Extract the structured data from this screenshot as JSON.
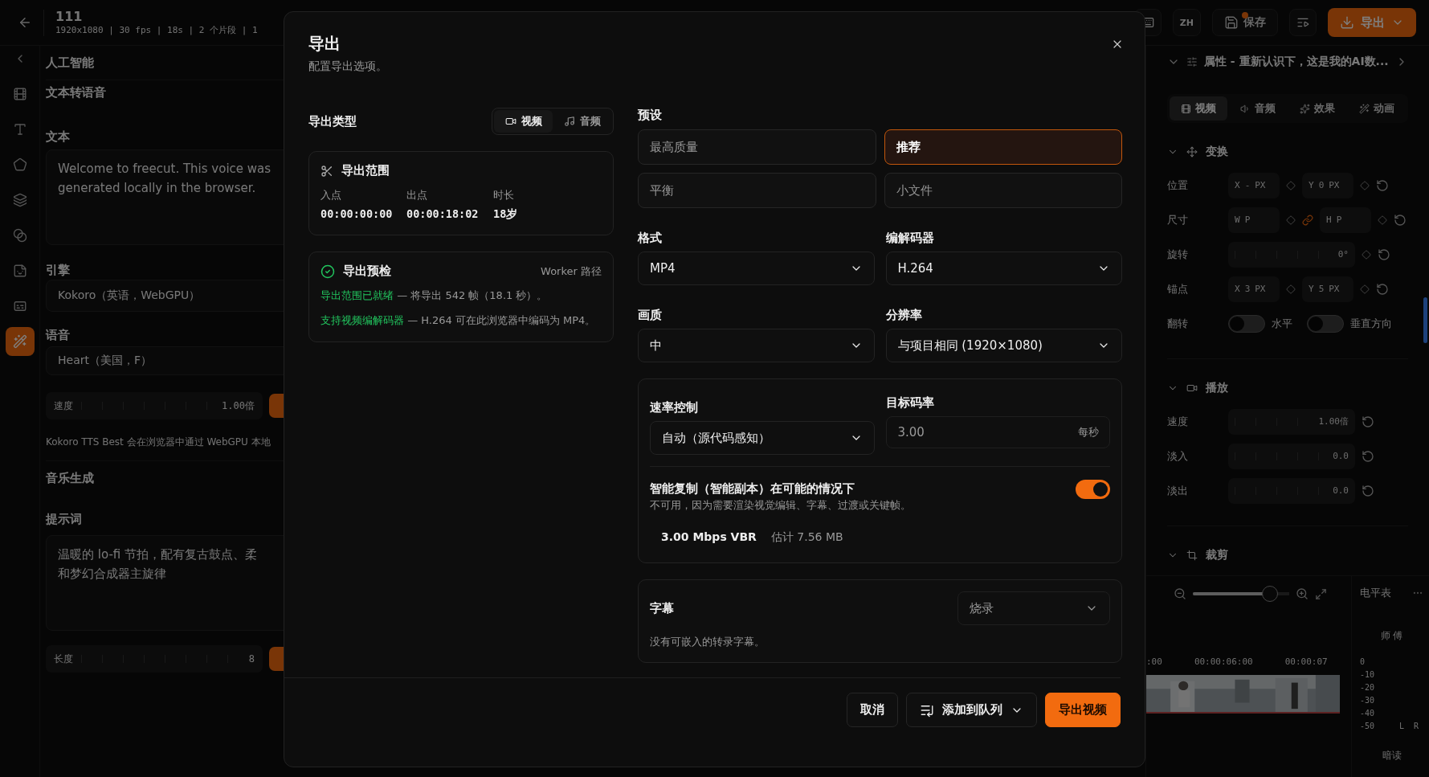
{
  "topbar": {
    "title": "111",
    "meta": "1920x1080 | 30 fps | 18s | 2 个片段 | 1",
    "language": "ZH",
    "save": "保存",
    "unsaved": true,
    "export": "导出"
  },
  "rail": [
    {
      "kind": "film",
      "selected": false
    },
    {
      "kind": "text",
      "selected": false
    },
    {
      "kind": "shape",
      "selected": false
    },
    {
      "kind": "layers",
      "selected": false
    },
    {
      "kind": "effects",
      "selected": false
    },
    {
      "kind": "sticker",
      "selected": false
    },
    {
      "kind": "captions",
      "selected": false
    },
    {
      "kind": "ai",
      "selected": true
    }
  ],
  "ai_panel": {
    "title": "人工智能",
    "tts": {
      "title": "文本转语音",
      "text_label": "文本",
      "text_lines": [
        "Welcome to freecut. This voice was",
        "generated locally in the browser."
      ],
      "engine_label": "引擎",
      "engine": "Kokoro（英语，WebGPU）",
      "voice_label": "语音",
      "voice": "Heart（美国，F）",
      "speed_label": "速度",
      "speed": "1.00倍",
      "note": "Kokoro TTS Best 会在浏览器中通过 WebGPU 本地"
    },
    "music": {
      "title": "音乐生成",
      "prompt_label": "提示词",
      "prompt_lines": [
        "温暖的 lo-fi 节拍，配有复古鼓点、柔",
        "和梦幻合成器主旋律"
      ],
      "length_label": "长度",
      "length": "8"
    }
  },
  "properties": {
    "title": "属性 - 重新认识下，这是我的AI数...",
    "tabs": [
      {
        "kind": "video",
        "label": "视频",
        "selected": true
      },
      {
        "kind": "audio",
        "label": "音频",
        "selected": false
      },
      {
        "kind": "effects",
        "label": "效果",
        "selected": false
      },
      {
        "kind": "animation",
        "label": "动画",
        "selected": false
      }
    ],
    "transform": {
      "title": "变换",
      "rows": [
        {
          "kind": "pair",
          "label": "位置",
          "fields": [
            {
              "axis": "X",
              "value": "-",
              "unit": "PX"
            },
            {
              "axis": "Y",
              "value": "0",
              "unit": "PX"
            }
          ]
        },
        {
          "kind": "linked",
          "label": "尺寸",
          "fields": [
            {
              "axis": "W",
              "unit": "P"
            },
            {
              "axis": "H",
              "unit": "P"
            }
          ]
        },
        {
          "kind": "slider",
          "label": "旋转",
          "value": "0°"
        },
        {
          "kind": "pair",
          "label": "锚点",
          "fields": [
            {
              "axis": "X",
              "value": "3",
              "unit": "PX"
            },
            {
              "axis": "Y",
              "value": "5",
              "unit": "PX"
            }
          ]
        },
        {
          "kind": "toggles",
          "label": "翻转",
          "options": [
            {
              "label": "水平",
              "on": false
            },
            {
              "label": "垂直方向",
              "on": false
            }
          ]
        }
      ]
    },
    "playback": {
      "title": "播放",
      "rows": [
        {
          "kind": "slider",
          "label": "速度",
          "value": "1.00倍"
        },
        {
          "kind": "slider",
          "label": "淡入",
          "value": "0.0"
        },
        {
          "kind": "slider",
          "label": "淡出",
          "value": "0.0"
        }
      ]
    },
    "crop": {
      "title": "裁剪"
    }
  },
  "timeline": {
    "zoom": {
      "level": 0.8
    },
    "ruler": [
      ":00",
      "00:00:06:00",
      "00:00:07"
    ]
  },
  "meter": {
    "title": "电平表",
    "label": "师 傅",
    "scale": [
      "0",
      "-10",
      "-20",
      "-30",
      "-40",
      "-50"
    ],
    "channels": [
      "L",
      "R"
    ],
    "footer": "暗读"
  },
  "modal": {
    "title": "导出",
    "subtitle": "配置导出选项。",
    "type_label": "导出类型",
    "types": [
      {
        "kind": "video",
        "label": "视频",
        "selected": true
      },
      {
        "kind": "audio",
        "label": "音频",
        "selected": false
      }
    ],
    "range": {
      "title": "导出范围",
      "columns": [
        {
          "label": "入点",
          "value": "00:00:00:00"
        },
        {
          "label": "出点",
          "value": "00:00:18:02"
        },
        {
          "label": "时长",
          "value": "18岁"
        }
      ]
    },
    "preflight": {
      "title": "导出预检",
      "path": "Worker 路径",
      "ok": true,
      "checks": [
        {
          "label": "导出范围已就绪",
          "text": " — 将导出 542 帧（18.1 秒）。"
        },
        {
          "label": "支持视频编解码器",
          "text": " — H.264 可在此浏览器中编码为 MP4。"
        }
      ]
    },
    "presets_label": "预设",
    "presets": [
      {
        "label": "最高质量",
        "selected": false
      },
      {
        "label": "推荐",
        "selected": true
      },
      {
        "label": "平衡",
        "selected": false
      },
      {
        "label": "小文件",
        "selected": false
      }
    ],
    "selects": [
      {
        "label": "格式",
        "value": "MP4"
      },
      {
        "label": "编解码器",
        "value": "H.264"
      },
      {
        "label": "画质",
        "value": "中"
      },
      {
        "label": "分辨率",
        "value": "与项目相同 (1920×1080)"
      }
    ],
    "rate": {
      "control_label": "速率控制",
      "control": "自动（源代码感知）",
      "target_label": "目标码率",
      "target": "3.00",
      "unit": "每秒",
      "smart_copy": {
        "title": "智能复制（智能副本）在可能的情况下",
        "note": "不可用，因为需要渲染视觉编辑、字幕、过渡或关键帧。",
        "on": true
      },
      "summary": "3.00 Mbps VBR",
      "estimate": "估计 7.56 MB"
    },
    "subtitles": {
      "title": "字幕",
      "mode": "烧录",
      "note": "没有可嵌入的转录字幕。"
    },
    "buttons": {
      "cancel": "取消",
      "queue": "添加到队列",
      "export": "导出视频"
    }
  }
}
